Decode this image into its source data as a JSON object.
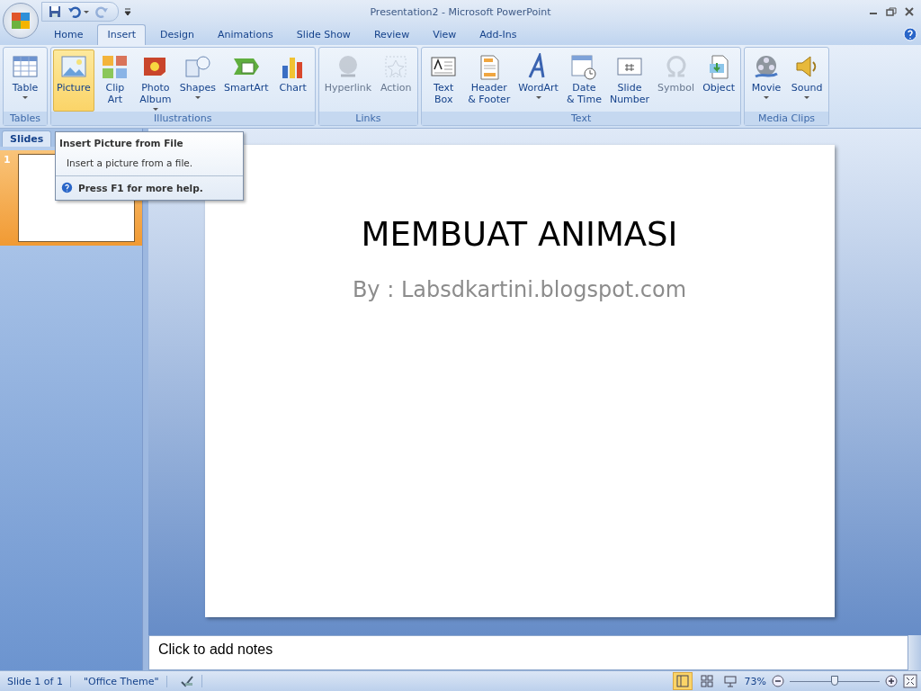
{
  "window": {
    "title": "Presentation2 - Microsoft PowerPoint"
  },
  "quick_access": [
    {
      "kind": "save",
      "disabled": false
    },
    {
      "kind": "undo",
      "dropdown": true,
      "disabled": false
    },
    {
      "kind": "redo",
      "disabled": true
    }
  ],
  "tabs": [
    {
      "label": "Home",
      "selected": false
    },
    {
      "label": "Insert",
      "selected": true
    },
    {
      "label": "Design",
      "selected": false
    },
    {
      "label": "Animations",
      "selected": false
    },
    {
      "label": "Slide Show",
      "selected": false
    },
    {
      "label": "Review",
      "selected": false
    },
    {
      "label": "View",
      "selected": false
    },
    {
      "label": "Add-Ins",
      "selected": false
    }
  ],
  "ribbon": [
    {
      "label": "Tables",
      "buttons": [
        {
          "label": "Table",
          "dropdown": true,
          "disabled": false,
          "selected": false
        }
      ]
    },
    {
      "label": "Illustrations",
      "buttons": [
        {
          "label": "Picture",
          "dropdown": false,
          "disabled": false,
          "selected": true
        },
        {
          "label": "Clip\nArt",
          "dropdown": false,
          "disabled": false,
          "selected": false
        },
        {
          "label": "Photo\nAlbum",
          "dropdown": true,
          "disabled": false,
          "selected": false
        },
        {
          "label": "Shapes",
          "dropdown": true,
          "disabled": false,
          "selected": false
        },
        {
          "label": "SmartArt",
          "dropdown": false,
          "disabled": false,
          "selected": false
        },
        {
          "label": "Chart",
          "dropdown": false,
          "disabled": false,
          "selected": false
        }
      ]
    },
    {
      "label": "Links",
      "buttons": [
        {
          "label": "Hyperlink",
          "dropdown": false,
          "disabled": true,
          "selected": false
        },
        {
          "label": "Action",
          "dropdown": false,
          "disabled": true,
          "selected": false
        }
      ]
    },
    {
      "label": "Text",
      "buttons": [
        {
          "label": "Text\nBox",
          "dropdown": false,
          "disabled": false,
          "selected": false
        },
        {
          "label": "Header\n& Footer",
          "dropdown": false,
          "disabled": false,
          "selected": false
        },
        {
          "label": "WordArt",
          "dropdown": true,
          "disabled": false,
          "selected": false
        },
        {
          "label": "Date\n& Time",
          "dropdown": false,
          "disabled": false,
          "selected": false
        },
        {
          "label": "Slide\nNumber",
          "dropdown": false,
          "disabled": false,
          "selected": false
        },
        {
          "label": "Symbol",
          "dropdown": false,
          "disabled": true,
          "selected": false
        },
        {
          "label": "Object",
          "dropdown": false,
          "disabled": false,
          "selected": false
        }
      ]
    },
    {
      "label": "Media Clips",
      "buttons": [
        {
          "label": "Movie",
          "dropdown": true,
          "disabled": false,
          "selected": false
        },
        {
          "label": "Sound",
          "dropdown": true,
          "disabled": false,
          "selected": false
        }
      ]
    }
  ],
  "tooltip": {
    "title": "Insert Picture from File",
    "body": "Insert a picture from a file.",
    "help": "Press F1 for more help."
  },
  "slides_panel": {
    "tab": "Slides",
    "thumbnails": [
      {
        "number": "1",
        "selected": true
      }
    ]
  },
  "slide": {
    "title": "MEMBUAT ANIMASI",
    "subtitle": "By : Labsdkartini.blogspot.com"
  },
  "notes": {
    "placeholder": "Click to add notes"
  },
  "status_bar": {
    "slide": "Slide 1 of 1",
    "theme": "\"Office Theme\"",
    "views": [
      {
        "kind": "normal",
        "selected": true
      },
      {
        "kind": "sorter",
        "selected": false
      },
      {
        "kind": "show",
        "selected": false
      }
    ],
    "zoom": "73%",
    "zoom_slider": {
      "level": 0.5
    }
  }
}
